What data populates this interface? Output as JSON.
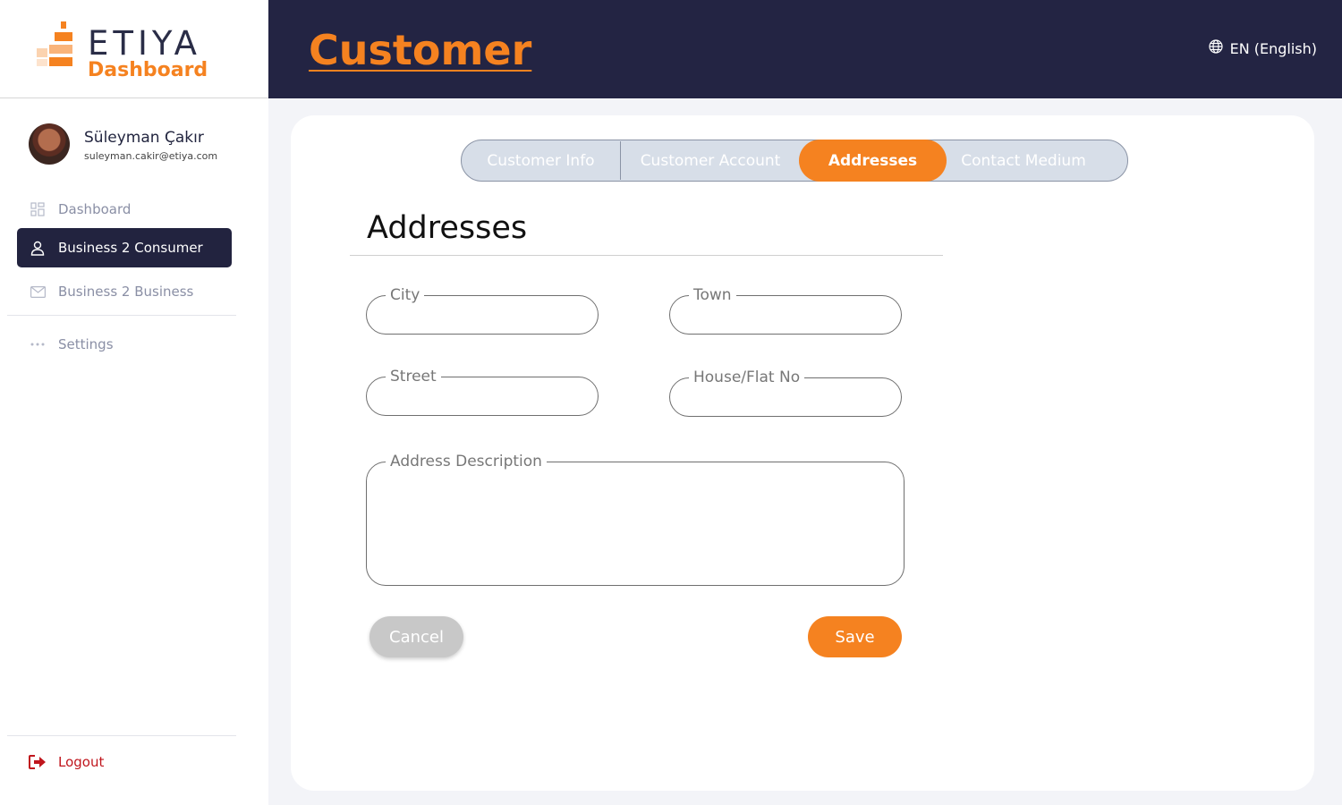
{
  "brand": {
    "name": "ETIYA",
    "sub": "Dashboard",
    "accent": "#f58220",
    "dark": "#232443"
  },
  "user": {
    "name": "Süleyman Çakır",
    "email": "suleyman.cakir@etiya.com"
  },
  "sidebar": {
    "items": [
      {
        "label": "Dashboard",
        "icon": "grid-icon"
      },
      {
        "label": "Business 2 Consumer",
        "icon": "user-icon",
        "active": true
      },
      {
        "label": "Business 2 Business",
        "icon": "mail-icon"
      },
      {
        "label": "Settings",
        "icon": "dots-icon"
      }
    ],
    "logout": {
      "label": "Logout",
      "icon": "logout-icon"
    }
  },
  "header": {
    "title": "Customer",
    "language": "EN (English)"
  },
  "tabs": [
    {
      "label": "Customer Info"
    },
    {
      "label": "Customer Account"
    },
    {
      "label": "Addresses",
      "active": true
    },
    {
      "label": "Contact Medium"
    }
  ],
  "form": {
    "title": "Addresses",
    "fields": {
      "city": {
        "label": "City",
        "value": ""
      },
      "town": {
        "label": "Town",
        "value": ""
      },
      "street": {
        "label": "Street",
        "value": ""
      },
      "house": {
        "label": "House/Flat No",
        "value": ""
      },
      "description": {
        "label": "Address Description",
        "value": ""
      }
    },
    "cancel_label": "Cancel",
    "save_label": "Save"
  }
}
